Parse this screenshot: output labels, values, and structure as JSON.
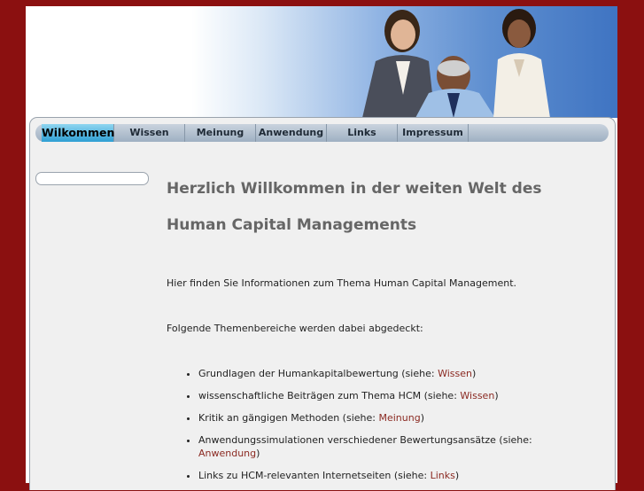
{
  "nav": {
    "items": [
      {
        "label": "Wilkommen",
        "active": true
      },
      {
        "label": "Wissen"
      },
      {
        "label": "Meinung"
      },
      {
        "label": "Anwendung"
      },
      {
        "label": "Links"
      },
      {
        "label": "Impressum"
      }
    ]
  },
  "main": {
    "title_line1": "Herzlich Willkommen in der weiten Welt des",
    "title_line2": "Human Capital Managements",
    "intro": "Hier finden Sie Informationen zum Thema Human Capital Management.",
    "topics_intro": "Folgende Themenbereiche werden dabei abgedeckt:",
    "list": [
      {
        "text": "Grundlagen der Humankapitalbewertung (siehe: ",
        "link": "Wissen",
        "after": ")"
      },
      {
        "text": "wissenschaftliche Beiträgen zum Thema HCM (siehe: ",
        "link": "Wissen",
        "after": ")"
      },
      {
        "text": "Kritik an gängigen Methoden (siehe: ",
        "link": "Meinung",
        "after": ")"
      },
      {
        "text": "Anwendungssimulationen verschiedener Bewertungsansätze (siehe: ",
        "link": "Anwendung",
        "after": ")"
      },
      {
        "text": "Links zu HCM-relevanten Internetseiten (siehe: ",
        "link": "Links",
        "after": ")"
      }
    ]
  },
  "colors": {
    "background": "#8b1010",
    "nav_active": "#2f9fd3",
    "link": "#8b2a22"
  }
}
